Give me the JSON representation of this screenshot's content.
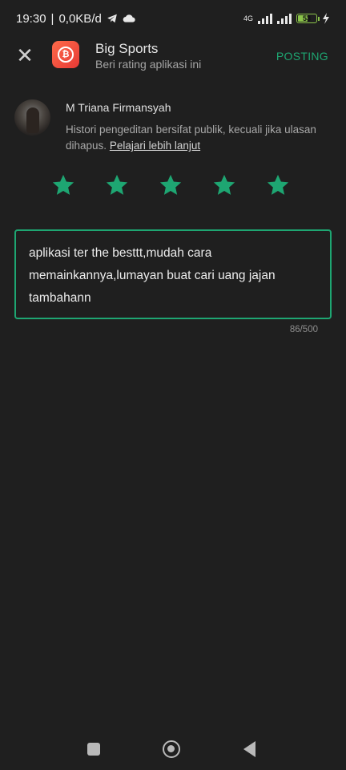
{
  "status_bar": {
    "time": "19:30",
    "separator": "|",
    "speed": "0,0KB/d",
    "network_label": "4G",
    "battery": "53",
    "icons": [
      "telegram-icon",
      "cloud-icon",
      "signal-icon",
      "battery-icon",
      "charging-icon"
    ]
  },
  "header": {
    "close_icon": "close-icon",
    "app_name": "Big Sports",
    "subtitle": "Beri rating aplikasi ini",
    "post_label": "POSTING"
  },
  "reviewer": {
    "name": "M Triana Firmansyah",
    "notice": "Histori pengeditan bersifat publik, kecuali jika ulasan dihapus.",
    "learn_more": "Pelajari lebih lanjut"
  },
  "rating": {
    "value": 5,
    "max": 5
  },
  "review": {
    "text": "aplikasi ter the besttt,mudah cara memainkannya,lumayan buat cari uang jajan tambahann",
    "counter": "86/500"
  },
  "colors": {
    "accent": "#1ea672",
    "background": "#1f1f1f"
  }
}
